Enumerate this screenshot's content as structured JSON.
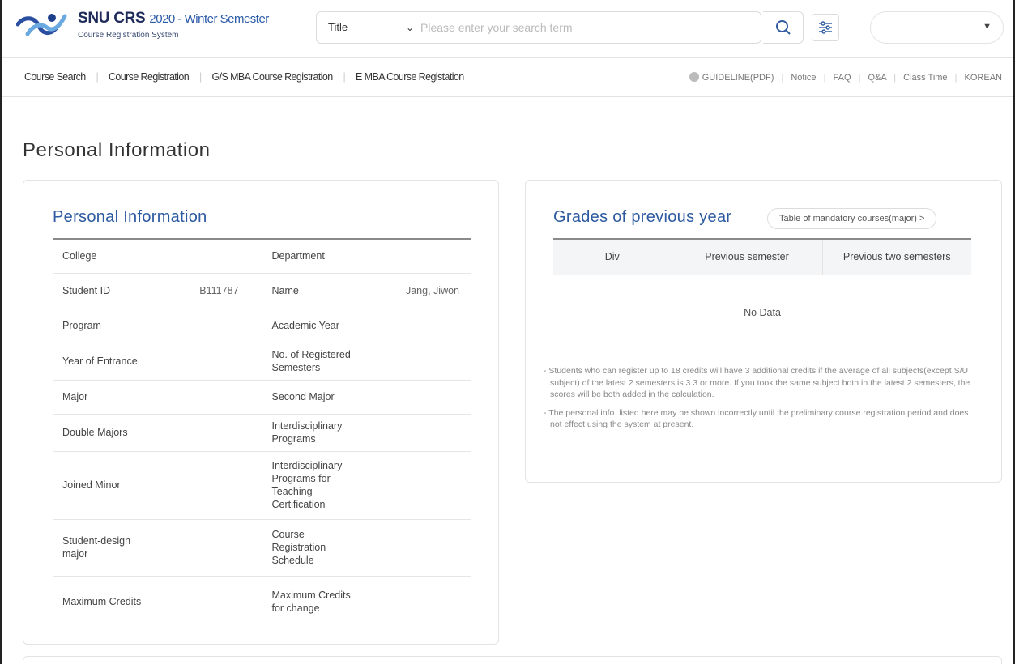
{
  "header": {
    "logo_title": "SNU CRS",
    "semester": "2020 - Winter Semester",
    "logo_subtitle": "Course Registration System",
    "search_type": "Title",
    "search_placeholder": "Please enter your search term",
    "search_icon": "search-icon",
    "filter_icon": "filter-sliders-icon",
    "user_caret_icon": "caret-down-icon"
  },
  "nav": {
    "items": [
      "Course Search",
      "Course Registration",
      "G/S MBA Course Registration",
      "E MBA Course Registation"
    ],
    "right_items": [
      "GUIDELINE(PDF)",
      "Notice",
      "FAQ",
      "Q&A",
      "Class Time",
      "KOREAN"
    ]
  },
  "page": {
    "title": "Personal Information"
  },
  "personal": {
    "title": "Personal Information",
    "rows": [
      {
        "l1": "College",
        "v1": "",
        "l2": "Department",
        "v2": ""
      },
      {
        "l1": "Student ID",
        "v1": "B111787",
        "l2": "Name",
        "v2": "Jang, Jiwon"
      },
      {
        "l1": "Program",
        "v1": "",
        "l2": "Academic Year",
        "v2": ""
      },
      {
        "l1": "Year of Entrance",
        "v1": "",
        "l2": "No. of Registered Semesters",
        "v2": ""
      },
      {
        "l1": "Major",
        "v1": "",
        "l2": "Second Major",
        "v2": ""
      },
      {
        "l1": "Double Majors",
        "v1": "",
        "l2": "Interdisciplinary Programs",
        "v2": ""
      },
      {
        "l1": "Joined Minor",
        "v1": "",
        "l2": "Interdisciplinary Programs for Teaching Certification",
        "v2": ""
      },
      {
        "l1": "Student-design major",
        "v1": "",
        "l2": "Course Registration Schedule",
        "v2": ""
      },
      {
        "l1": "Maximum Credits",
        "v1": "",
        "l2": "Maximum Credits for change",
        "v2": ""
      }
    ]
  },
  "grades": {
    "title": "Grades of previous year",
    "mandatory_button": "Table of mandatory courses(major) >",
    "columns": [
      "Div",
      "Previous semester",
      "Previous two semesters"
    ],
    "empty_text": "No Data",
    "notes": [
      "- Students who can register up to 18 credits will have 3 additional credits if the average of all subjects(except S/U subject) of the latest 2 semesters is 3.3 or more. If you took the same subject both in the latest 2 semesters, the scores will be both added in the calculation.",
      "- The personal info. listed here may be shown incorrectly until the preliminary course registration period and does not effect using the system at present."
    ]
  }
}
